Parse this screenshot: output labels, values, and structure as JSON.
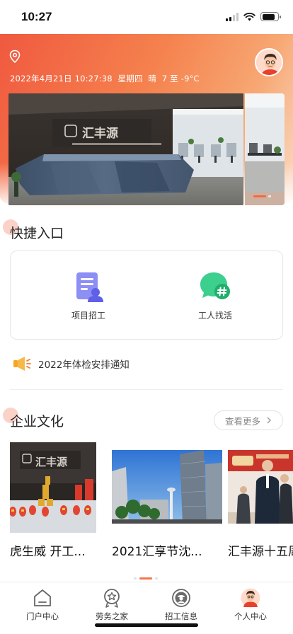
{
  "status_bar": {
    "time": "10:27",
    "battery_level": 0.85
  },
  "header": {
    "datetime": "2022年4月21日 10:27:38",
    "weekday": "星期四",
    "weather": "晴",
    "temperature": "7 至 -9°C"
  },
  "banner": {
    "company_sign": "汇丰源",
    "page_count": 2,
    "active_index": 0
  },
  "quick": {
    "title": "快捷入口",
    "items": [
      {
        "label": "项目招工",
        "icon": "document-person-icon"
      },
      {
        "label": "工人找活",
        "icon": "chat-hashtag-icon"
      }
    ]
  },
  "notice": {
    "text": "2022年体检安排通知",
    "icon": "megaphone-icon"
  },
  "culture": {
    "title": "企业文化",
    "more_label": "查看更多",
    "cards": [
      {
        "title": "虎生威 开工..."
      },
      {
        "title": "2021汇享节沈..."
      },
      {
        "title": "汇丰源十五周"
      }
    ]
  },
  "tabbar": {
    "items": [
      {
        "label": "门户中心",
        "icon": "home-icon"
      },
      {
        "label": "劳务之家",
        "icon": "badge-star-icon"
      },
      {
        "label": "招工信息",
        "icon": "worker-icon"
      },
      {
        "label": "个人中心",
        "icon": "avatar-icon"
      }
    ]
  },
  "colors": {
    "accent": "#f36a3f",
    "quick_icon_1": "#7d7ff0",
    "quick_icon_2": "#3ccf8e"
  }
}
